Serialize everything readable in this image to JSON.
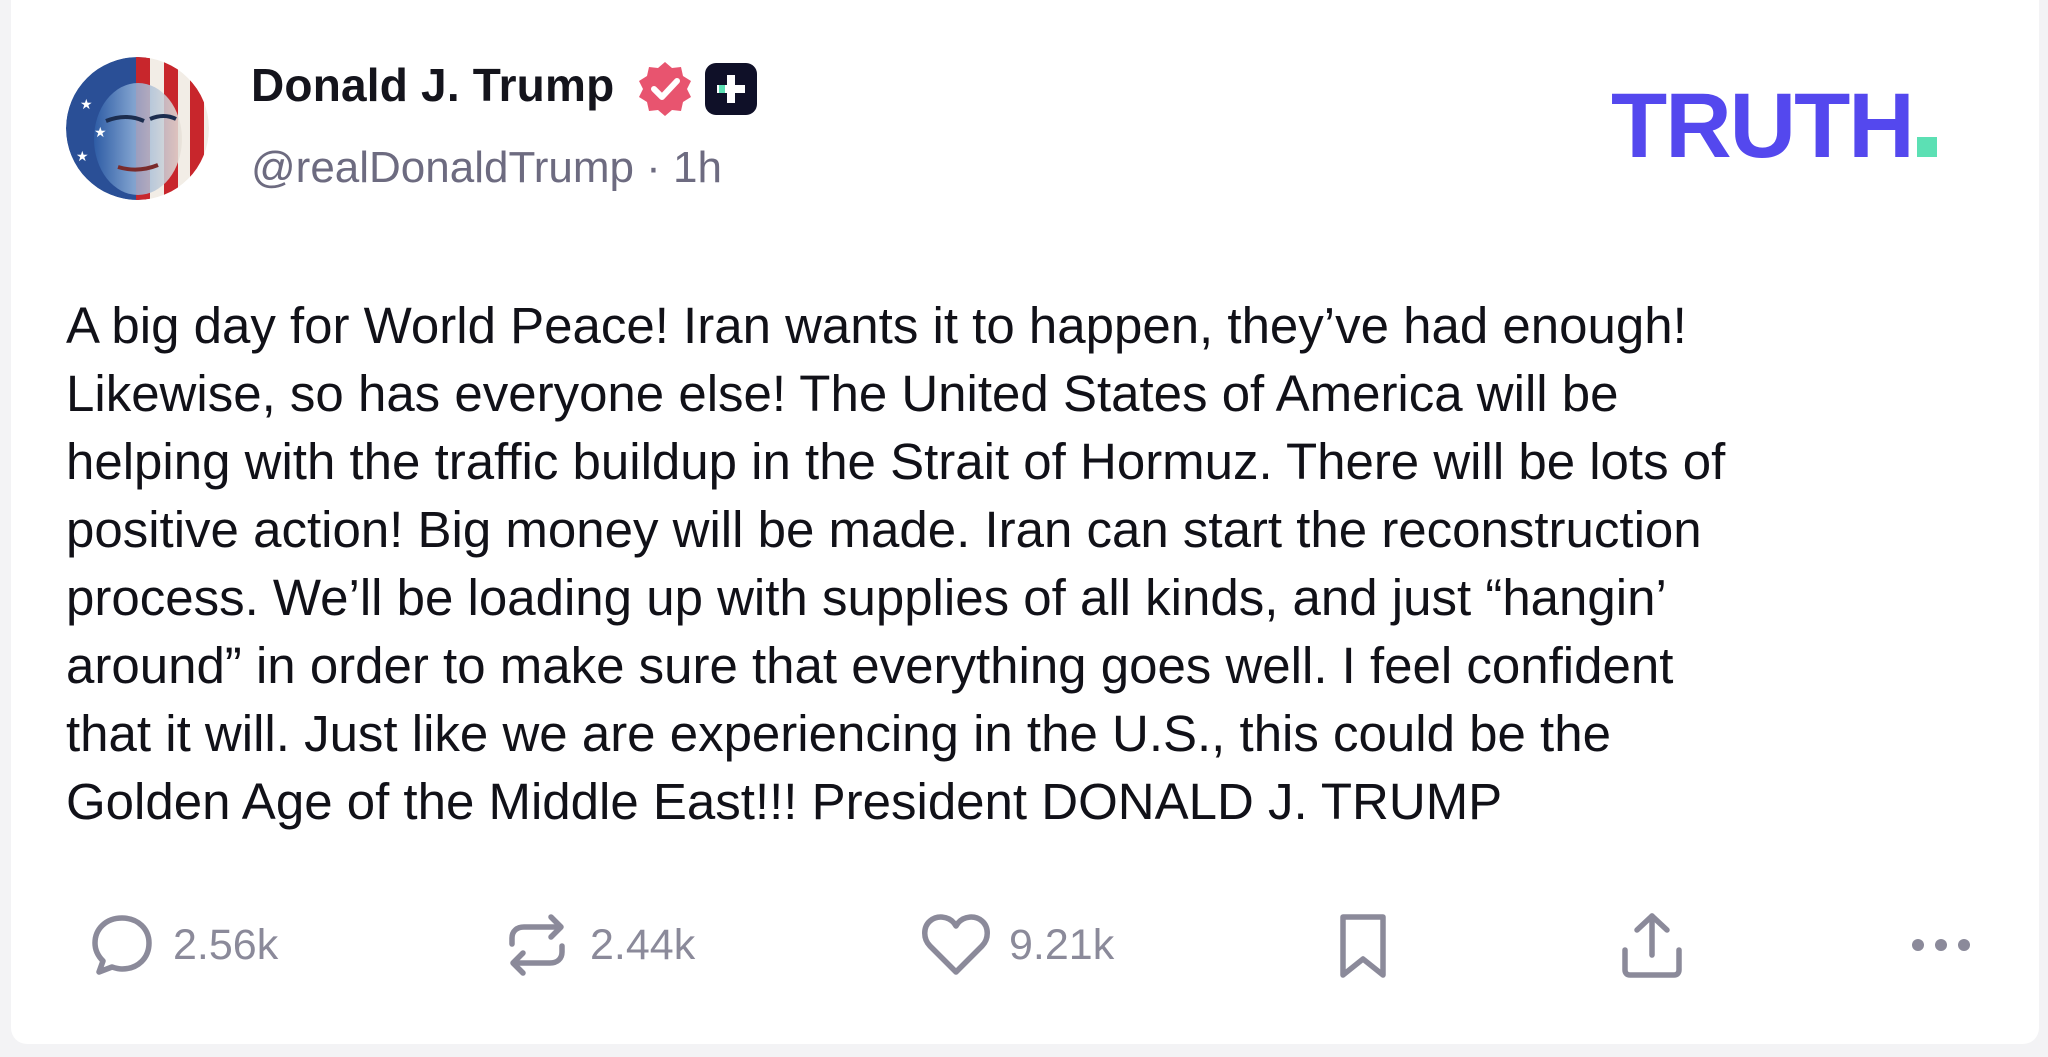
{
  "post": {
    "author": {
      "display_name": "Donald J. Trump",
      "handle_line": "@realDonaldTrump · 1h",
      "verified_icon": "verified-badge-icon",
      "plus_icon": "truth-plus-icon"
    },
    "brand": {
      "logo_text": "TRUTH",
      "primary_color": "#5448ee",
      "accent_color": "#5ce0b4"
    },
    "body_lines": [
      "A big day for World Peace! Iran wants it to happen, they’ve had enough!",
      "Likewise, so has everyone else! The United States of America will be",
      "helping with the traffic buildup in the Strait of Hormuz. There will be lots of",
      "positive action! Big money will be made. Iran can start the reconstruction",
      "process. We’ll be loading up with supplies of all kinds, and just “hangin’",
      "around” in order to make sure that everything goes well. I feel confident",
      "that it will. Just like we are experiencing in the U.S., this could be the",
      "Golden Age of the Middle East!!! President DONALD J. TRUMP"
    ],
    "actions": {
      "reply": {
        "icon": "reply-icon",
        "count": "2.56k"
      },
      "retruth": {
        "icon": "retruth-icon",
        "count": "2.44k"
      },
      "like": {
        "icon": "heart-icon",
        "count": "9.21k"
      },
      "bookmark": {
        "icon": "bookmark-icon"
      },
      "share": {
        "icon": "share-icon"
      },
      "more": {
        "icon": "more-icon"
      }
    },
    "colors": {
      "verified": "#e8546f",
      "text": "#111118",
      "muted": "#6d6b80",
      "action_gray": "#8b8a9a"
    }
  }
}
